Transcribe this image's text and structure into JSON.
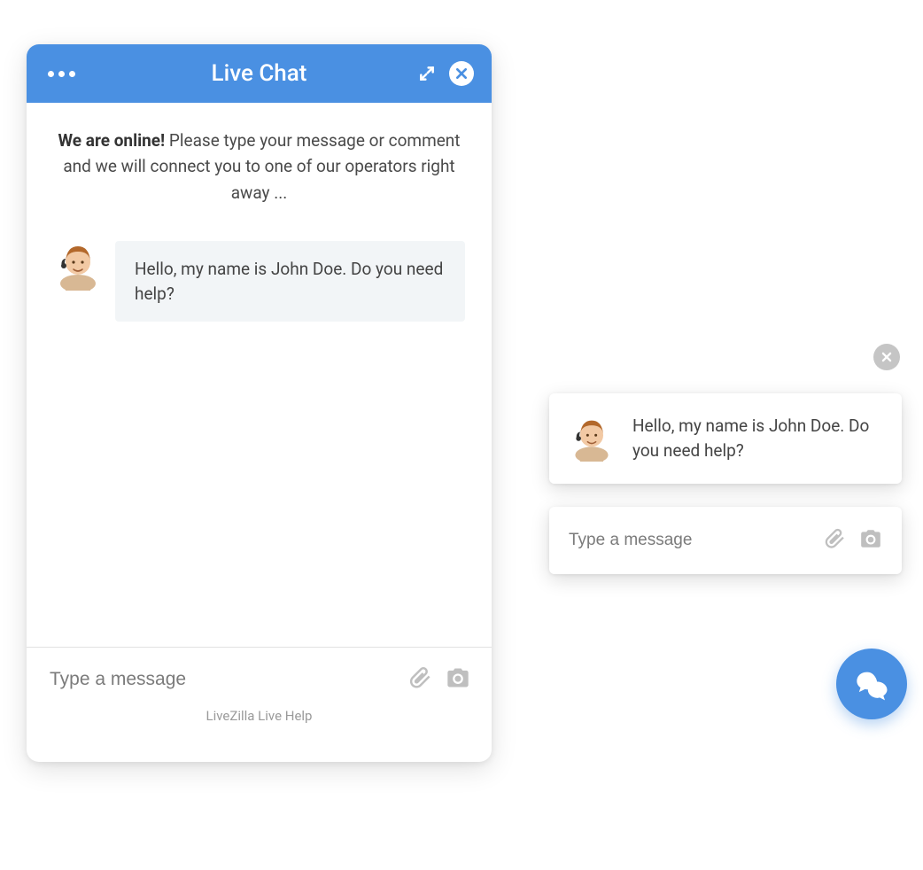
{
  "chatWindow": {
    "title": "Live Chat",
    "welcomeBold": "We are online!",
    "welcomeText": " Please type your message or comment and we will connect you to one of our operators right away ...",
    "operatorMessage": "Hello, my name is John Doe. Do you need help?",
    "inputPlaceholder": "Type a message",
    "footer": "LiveZilla Live Help"
  },
  "compact": {
    "operatorMessage": "Hello, my name is John Doe. Do you need help?",
    "inputPlaceholder": "Type a message"
  }
}
